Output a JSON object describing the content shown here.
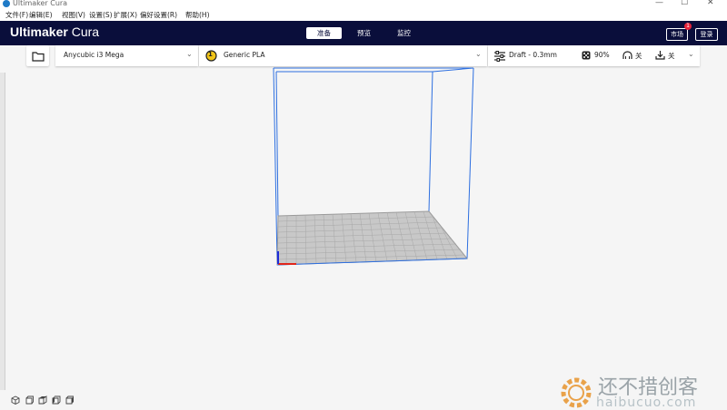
{
  "window": {
    "title": "Ultimaker Cura"
  },
  "menu": [
    "文件(F)",
    "编辑(E)",
    "视图(V)",
    "设置(S)",
    "扩展(X)",
    "偏好设置(R)",
    "帮助(H)"
  ],
  "header": {
    "brand_bold": "Ultimaker",
    "brand_light": "Cura",
    "stages": [
      "准备",
      "预览",
      "监控"
    ],
    "active_stage": "准备",
    "marketplace": "市场",
    "marketplace_badge": "1",
    "signin": "登录"
  },
  "toolbar": {
    "printer": "Anycubic i3 Mega",
    "extruder_number": "1",
    "material": "Generic PLA",
    "profile": "Draft - 0.3mm",
    "infill": "90%",
    "support": "关",
    "adhesion": "关"
  },
  "colors": {
    "header_bg": "#0a0e3b",
    "build_volume_line": "#2d6fe0",
    "plate": "#c8c8c8"
  },
  "watermark": {
    "text": "还不措创客",
    "sub": "haibucuo.com"
  }
}
